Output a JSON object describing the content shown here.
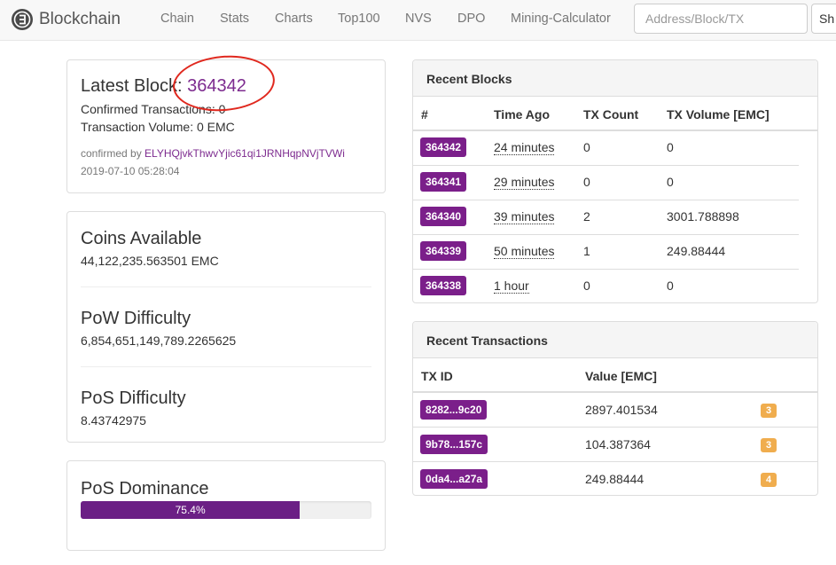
{
  "navbar": {
    "brand": "Blockchain",
    "links": [
      "Chain",
      "Stats",
      "Charts",
      "Top100",
      "NVS",
      "DPO",
      "Mining-Calculator"
    ],
    "search_placeholder": "Address/Block/TX",
    "search_button": "Sh"
  },
  "latest_block": {
    "label": "Latest Block:",
    "number": "364342",
    "confirmed_tx": "Confirmed Transactions: 0",
    "tx_volume": "Transaction Volume: 0 EMC",
    "confirmed_by_label": "confirmed by",
    "confirmed_by_address": "ELYHQjvkThwvYjic61qi1JRNHqpNVjTVWi",
    "timestamp": "2019-07-10 05:28:04"
  },
  "stats": {
    "coins_available": {
      "title": "Coins Available",
      "value": "44,122,235.563501 EMC"
    },
    "pow_difficulty": {
      "title": "PoW Difficulty",
      "value": "6,854,651,149,789.2265625"
    },
    "pos_difficulty": {
      "title": "PoS Difficulty",
      "value": "8.43742975"
    }
  },
  "pos_dominance": {
    "title": "PoS Dominance",
    "label": "75.4%",
    "percent": 75.4
  },
  "recent_blocks": {
    "title": "Recent Blocks",
    "columns": [
      "#",
      "Time Ago",
      "TX Count",
      "TX Volume [EMC]"
    ],
    "rows": [
      {
        "block": "364342",
        "time": "24 minutes",
        "tx_count": "0",
        "tx_volume": "0"
      },
      {
        "block": "364341",
        "time": "29 minutes",
        "tx_count": "0",
        "tx_volume": "0"
      },
      {
        "block": "364340",
        "time": "39 minutes",
        "tx_count": "2",
        "tx_volume": "3001.788898"
      },
      {
        "block": "364339",
        "time": "50 minutes",
        "tx_count": "1",
        "tx_volume": "249.88444"
      },
      {
        "block": "364338",
        "time": "1 hour",
        "tx_count": "0",
        "tx_volume": "0"
      }
    ]
  },
  "recent_transactions": {
    "title": "Recent Transactions",
    "columns": [
      "TX ID",
      "Value [EMC]"
    ],
    "rows": [
      {
        "txid": "8282...9c20",
        "value": "2897.401534",
        "confirmations": "3"
      },
      {
        "txid": "9b78...157c",
        "value": "104.387364",
        "confirmations": "3"
      },
      {
        "txid": "0da4...a27a",
        "value": "249.88444",
        "confirmations": "4"
      }
    ]
  },
  "colors": {
    "accent": "#7b1f8a",
    "link": "#7d2b8f",
    "progress": "#6b1f85",
    "warning_badge": "#f0ad4e",
    "annotation": "#e0281e"
  },
  "icons": {
    "brand": "blockchain-logo-icon"
  }
}
